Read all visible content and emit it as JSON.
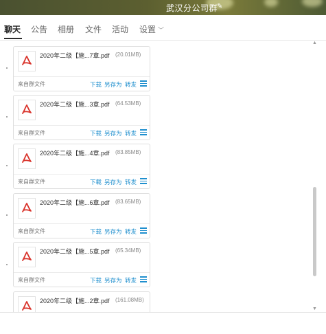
{
  "window": {
    "title": "武汉分公司群",
    "edit_icon": "pencil-icon"
  },
  "tabs": [
    {
      "label": "聊天",
      "active": true
    },
    {
      "label": "公告"
    },
    {
      "label": "相册"
    },
    {
      "label": "文件"
    },
    {
      "label": "活动"
    },
    {
      "label": "设置"
    }
  ],
  "files": [
    {
      "name": "2020年二级【施...7章.pdf",
      "size": "(20.01MB)",
      "source": "来自群文件",
      "download": "下载",
      "save_as": "另存为",
      "forward": "转发"
    },
    {
      "name": "2020年二级【施...3章.pdf",
      "size": "(64.53MB)",
      "source": "来自群文件",
      "download": "下载",
      "save_as": "另存为",
      "forward": "转发"
    },
    {
      "name": "2020年二级【施...4章.pdf",
      "size": "(83.85MB)",
      "source": "来自群文件",
      "download": "下载",
      "save_as": "另存为",
      "forward": "转发"
    },
    {
      "name": "2020年二级【施...6章.pdf",
      "size": "(83.65MB)",
      "source": "来自群文件",
      "download": "下载",
      "save_as": "另存为",
      "forward": "转发"
    },
    {
      "name": "2020年二级【施...5章.pdf",
      "size": "(65.34MB)",
      "source": "来自群文件",
      "download": "下载",
      "save_as": "另存为",
      "forward": "转发"
    },
    {
      "name": "2020年二级【施...2章.pdf",
      "size": "(161.08MB)",
      "source": "",
      "download": "",
      "save_as": "",
      "forward": ""
    }
  ],
  "colors": {
    "link": "#1f8fce",
    "pdf_red": "#d9332b",
    "header": "#5c5f30"
  }
}
